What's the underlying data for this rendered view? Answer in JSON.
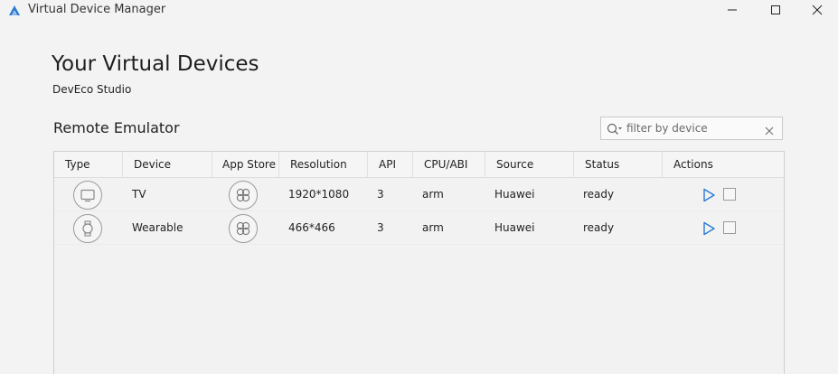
{
  "window": {
    "title": "Virtual Device Manager",
    "icon": "deveco-logo-icon",
    "controls": [
      "minimize-icon",
      "maximize-icon",
      "close-icon"
    ]
  },
  "header": {
    "title": "Your Virtual Devices",
    "subtitle": "DevEco Studio"
  },
  "section": {
    "title": "Remote Emulator"
  },
  "filter": {
    "placeholder": "filter by device",
    "value": ""
  },
  "table": {
    "columns": [
      "Type",
      "Device",
      "App Store",
      "Resolution",
      "API",
      "CPU/ABI",
      "Source",
      "Status",
      "Actions"
    ],
    "rows": [
      {
        "type_icon": "tv-icon",
        "device": "TV",
        "app_store_icon": "app-store-icon",
        "resolution": "1920*1080",
        "api": "3",
        "cpu": "arm",
        "source": "Huawei",
        "status": "ready",
        "actions": [
          "play-icon",
          "stop-icon"
        ]
      },
      {
        "type_icon": "watch-icon",
        "device": "Wearable",
        "app_store_icon": "app-store-icon",
        "resolution": "466*466",
        "api": "3",
        "cpu": "arm",
        "source": "Huawei",
        "status": "ready",
        "actions": [
          "play-icon",
          "stop-icon"
        ]
      }
    ]
  },
  "colors": {
    "background": "#f3f3f3",
    "accent": "#2a7ad5",
    "border": "#cfcfcf"
  }
}
